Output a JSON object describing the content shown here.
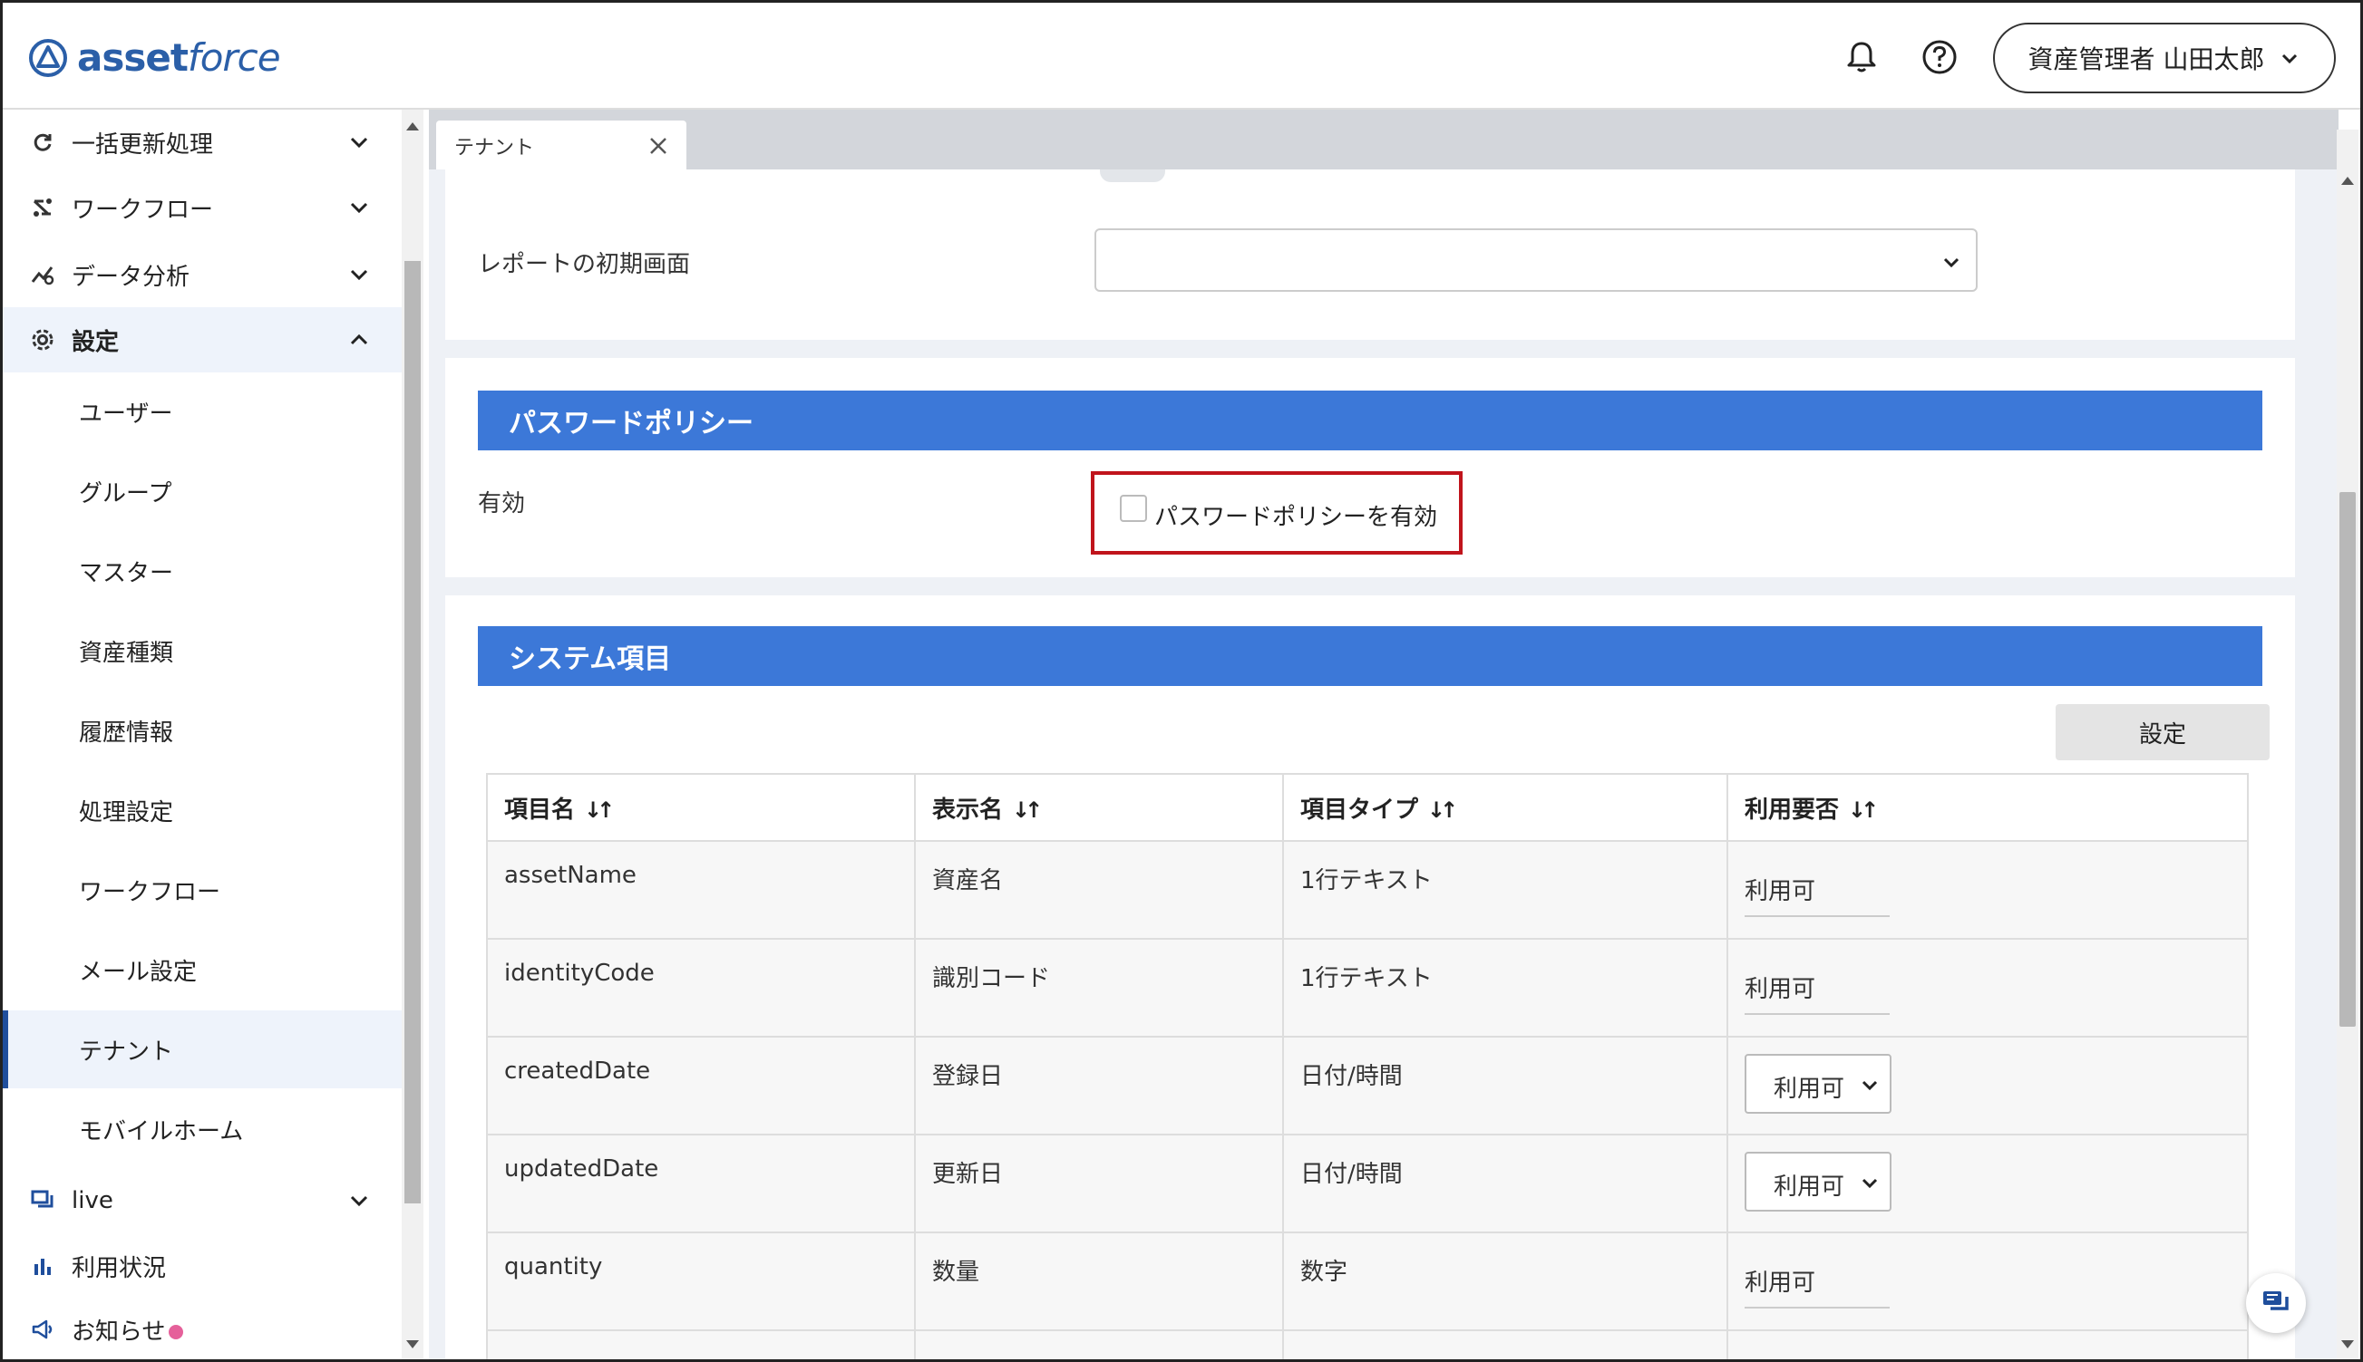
{
  "app": {
    "logo_text_bold": "asset",
    "logo_text_light": "force"
  },
  "header": {
    "user_label": "資産管理者 山田太郎"
  },
  "sidebar": {
    "top_items": [
      {
        "label": "一括更新処理",
        "icon": "refresh-icon"
      },
      {
        "label": "ワークフロー",
        "icon": "workflow-icon"
      },
      {
        "label": "データ分析",
        "icon": "analytics-icon"
      },
      {
        "label": "設定",
        "icon": "gear-icon"
      }
    ],
    "settings_items": [
      "ユーザー",
      "グループ",
      "マスター",
      "資産種類",
      "履歴情報",
      "処理設定",
      "ワークフロー",
      "メール設定",
      "テナント",
      "モバイルホーム"
    ],
    "bottom_items": [
      {
        "label": "live",
        "icon": "chat-icon"
      },
      {
        "label": "利用状況",
        "icon": "bar-chart-icon"
      },
      {
        "label": "お知らせ",
        "icon": "megaphone-icon"
      }
    ]
  },
  "tab": {
    "label": "テナント"
  },
  "report": {
    "label": "レポートの初期画面",
    "value": ""
  },
  "password_policy": {
    "title": "パスワードポリシー",
    "field_label": "有効",
    "checkbox_label": "パスワードポリシーを有効",
    "checked": false
  },
  "system_items": {
    "title": "システム項目",
    "set_button": "設定",
    "columns": [
      "項目名",
      "表示名",
      "項目タイプ",
      "利用要否"
    ],
    "sort_icon": "↓↑",
    "rows": [
      {
        "name": "assetName",
        "display": "資産名",
        "type": "1行テキスト",
        "usage": "利用可",
        "editable": false
      },
      {
        "name": "identityCode",
        "display": "識別コード",
        "type": "1行テキスト",
        "usage": "利用可",
        "editable": false
      },
      {
        "name": "createdDate",
        "display": "登録日",
        "type": "日付/時間",
        "usage": "利用可",
        "editable": true
      },
      {
        "name": "updatedDate",
        "display": "更新日",
        "type": "日付/時間",
        "usage": "利用可",
        "editable": true
      },
      {
        "name": "quantity",
        "display": "数量",
        "type": "数字",
        "usage": "利用可",
        "editable": false
      }
    ]
  },
  "colors": {
    "accent": "#3c78d8",
    "brand": "#2b5fa8",
    "highlight": "#c0141c",
    "notify_dot": "#e5609a"
  }
}
